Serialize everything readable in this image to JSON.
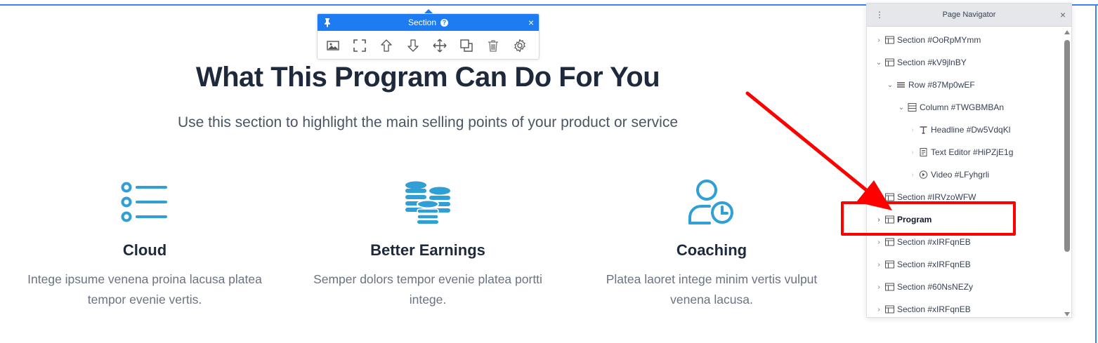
{
  "toolbar": {
    "title": "Section",
    "help": "?",
    "close": "×",
    "icons": [
      "image-icon",
      "fullscreen-icon",
      "move-up-icon",
      "move-down-icon",
      "move-icon",
      "duplicate-icon",
      "delete-icon",
      "settings-icon"
    ]
  },
  "main": {
    "headline": "What This Program Can Do For You",
    "subtext": "Use this section to highlight the main selling points of your product or service",
    "features": [
      {
        "icon": "list-icon",
        "title": "Cloud",
        "text": "Intege ipsume venena proina lacusa platea tempor evenie vertis."
      },
      {
        "icon": "coins-icon",
        "title": "Better Earnings",
        "text": "Semper dolors tempor evenie platea portti intege."
      },
      {
        "icon": "user-clock-icon",
        "title": "Coaching",
        "text": "Platea laoret intege minim vertis vulput venena lacusa."
      }
    ]
  },
  "navigator": {
    "title": "Page Navigator",
    "menu": "⋮",
    "close": "×",
    "items": [
      {
        "label": "Section #OoRpMYmm",
        "depth": 0,
        "icon": "section-icon",
        "expanded": false
      },
      {
        "label": "Section #kV9jlnBY",
        "depth": 0,
        "icon": "section-icon",
        "expanded": true
      },
      {
        "label": "Row #87Mp0wEF",
        "depth": 1,
        "icon": "row-icon",
        "expanded": true
      },
      {
        "label": "Column #TWGBMBAn",
        "depth": 2,
        "icon": "column-icon",
        "expanded": true
      },
      {
        "label": "Headline #Dw5VdqKl",
        "depth": 3,
        "icon": "headline-icon",
        "expanded": false
      },
      {
        "label": "Text Editor #HiPZjE1g",
        "depth": 3,
        "icon": "text-editor-icon",
        "expanded": false
      },
      {
        "label": "Video #LFyhgrli",
        "depth": 3,
        "icon": "video-icon",
        "expanded": false
      },
      {
        "label": "Section #IRVzoWFW",
        "depth": 0,
        "icon": "section-icon",
        "expanded": false
      },
      {
        "label": "Program",
        "depth": 0,
        "icon": "section-icon",
        "expanded": false,
        "bold": true
      },
      {
        "label": "Section #xIRFqnEB",
        "depth": 0,
        "icon": "section-icon",
        "expanded": false
      },
      {
        "label": "Section #xIRFqnEB",
        "depth": 0,
        "icon": "section-icon",
        "expanded": false
      },
      {
        "label": "Section #60NsNEZy",
        "depth": 0,
        "icon": "section-icon",
        "expanded": false
      },
      {
        "label": "Section #xIRFqnEB",
        "depth": 0,
        "icon": "section-icon",
        "expanded": false
      }
    ]
  },
  "colors": {
    "accent": "#1e7cf2",
    "icon_blue": "#2f9fd6",
    "annotation_red": "#ff0000"
  }
}
